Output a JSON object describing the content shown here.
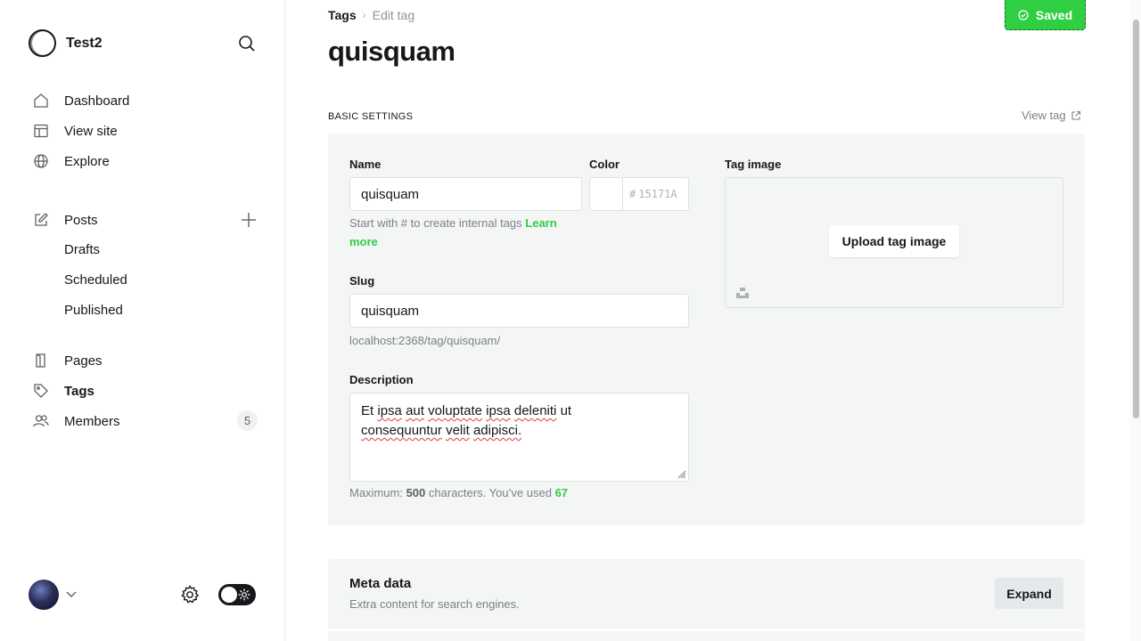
{
  "app": {
    "site_name": "Test2"
  },
  "sidebar": {
    "nav": [
      {
        "label": "Dashboard",
        "icon": "home-icon"
      },
      {
        "label": "View site",
        "icon": "layout-icon"
      },
      {
        "label": "Explore",
        "icon": "globe-icon"
      }
    ],
    "posts": {
      "label": "Posts",
      "icon": "edit-icon"
    },
    "post_subitems": [
      "Drafts",
      "Scheduled",
      "Published"
    ],
    "pages": {
      "label": "Pages",
      "icon": "page-icon"
    },
    "tags": {
      "label": "Tags",
      "icon": "tag-icon"
    },
    "members": {
      "label": "Members",
      "icon": "members-icon",
      "count": "5"
    }
  },
  "header": {
    "breadcrumb_root": "Tags",
    "breadcrumb_separator": "›",
    "breadcrumb_current": "Edit tag",
    "saved_label": "Saved",
    "title": "quisquam"
  },
  "basic_settings": {
    "section_label": "BASIC SETTINGS",
    "view_tag_label": "View tag",
    "name_label": "Name",
    "name_value": "quisquam",
    "name_hint": "Start with # to create internal tags",
    "learn_more": "Learn more",
    "color_label": "Color",
    "color_hash": "#",
    "color_placeholder": "15171A",
    "slug_label": "Slug",
    "slug_value": "quisquam",
    "slug_url": "localhost:2368/tag/quisquam/",
    "description_label": "Description",
    "description_words": [
      "Et",
      "ipsa",
      "aut",
      "voluptate",
      "ipsa",
      "deleniti",
      "ut",
      "consequuntur",
      "velit",
      "adipisci."
    ],
    "count_prefix": "Maximum:",
    "count_max": "500",
    "count_middle": "characters. You’ve used",
    "count_used": "67",
    "tag_image_label": "Tag image",
    "upload_label": "Upload tag image"
  },
  "meta": {
    "title": "Meta data",
    "subtitle": "Extra content for search engines.",
    "expand_label": "Expand"
  },
  "colors": {
    "accent_green": "#30cf43",
    "panel_bg": "#f4f5f5",
    "text_dark": "#15171a",
    "text_muted": "#7c8187"
  }
}
